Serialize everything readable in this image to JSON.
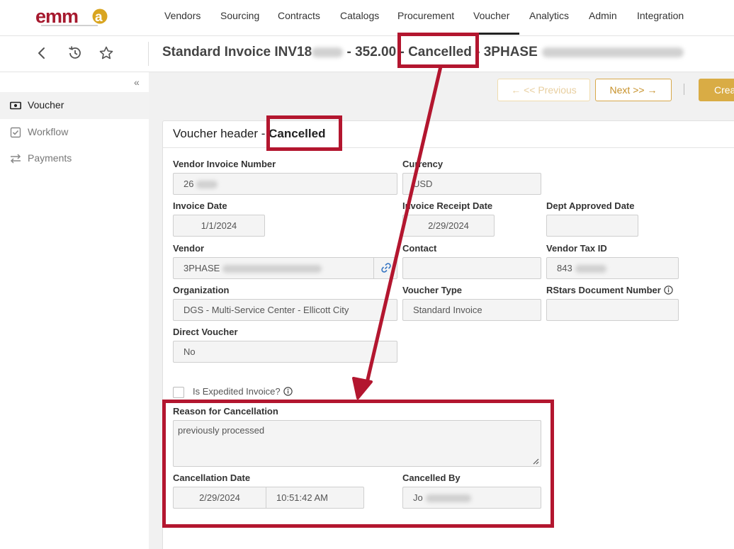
{
  "nav": {
    "logo_text": "emma",
    "logo_tagline": "eMaryland Marketplace Advantage",
    "items": [
      "Vendors",
      "Sourcing",
      "Contracts",
      "Catalogs",
      "Procurement",
      "Voucher",
      "Analytics",
      "Admin",
      "Integration"
    ],
    "active": "Voucher"
  },
  "header": {
    "title_prefix": "Standard Invoice INV18",
    "title_amount": " - 352.00 - ",
    "title_status": "Cancelled",
    "title_sep": " - ",
    "title_vendor": "3PHASE"
  },
  "sidebar": {
    "collapse": "«",
    "items": [
      {
        "label": "Voucher",
        "icon": "money-icon"
      },
      {
        "label": "Workflow",
        "icon": "checkbox-icon"
      },
      {
        "label": "Payments",
        "icon": "transfer-icon"
      }
    ]
  },
  "actions": {
    "previous": "← << Previous",
    "next": "Next >> →",
    "create": "Crea"
  },
  "card": {
    "title_prefix": "Voucher header - ",
    "title_status": "Cancelled"
  },
  "fields": {
    "vendor_invoice_number": {
      "label": "Vendor Invoice Number",
      "value": "26"
    },
    "currency": {
      "label": "Currency",
      "value": "USD"
    },
    "invoice_date": {
      "label": "Invoice Date",
      "value": "1/1/2024"
    },
    "invoice_receipt_date": {
      "label": "Invoice Receipt Date",
      "value": "2/29/2024"
    },
    "dept_approved_date": {
      "label": "Dept Approved Date",
      "value": ""
    },
    "vendor": {
      "label": "Vendor",
      "value": "3PHASE"
    },
    "contact": {
      "label": "Contact",
      "value": ""
    },
    "vendor_tax_id": {
      "label": "Vendor Tax ID",
      "value": "843"
    },
    "organization": {
      "label": "Organization",
      "value": "DGS - Multi-Service Center - Ellicott City"
    },
    "voucher_type": {
      "label": "Voucher Type",
      "value": "Standard Invoice"
    },
    "rstars_document_number": {
      "label": "RStars Document Number",
      "value": ""
    },
    "direct_voucher": {
      "label": "Direct Voucher",
      "value": "No"
    },
    "is_expedited": {
      "label": "Is Expedited Invoice?",
      "checked": false
    },
    "reason_for_cancellation": {
      "label": "Reason for Cancellation",
      "value": "previously processed"
    },
    "cancellation_date": {
      "label": "Cancellation Date",
      "date": "2/29/2024",
      "time": "10:51:42 AM"
    },
    "cancelled_by": {
      "label": "Cancelled By",
      "value": "Jo"
    }
  },
  "colors": {
    "accent": "#d9ac45",
    "annotation": "#b3162f",
    "logo_red": "#a6192e",
    "logo_gold": "#d9a520"
  }
}
